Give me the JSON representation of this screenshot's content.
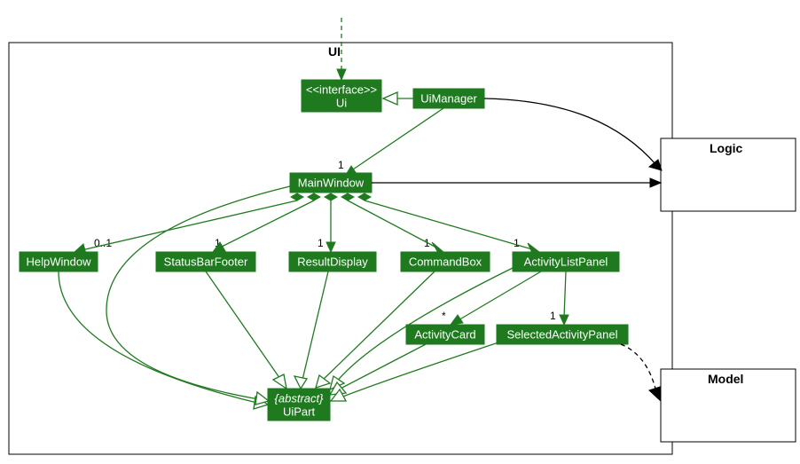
{
  "packages": {
    "ui": {
      "label": "UI"
    },
    "logic": {
      "label": "Logic"
    },
    "model": {
      "label": "Model"
    }
  },
  "nodes": {
    "ui_if": {
      "stereo": "<<interface>>",
      "name": "Ui"
    },
    "ui_manager": {
      "name": "UiManager"
    },
    "main_window": {
      "name": "MainWindow"
    },
    "help": {
      "name": "HelpWindow"
    },
    "status": {
      "name": "StatusBarFooter"
    },
    "result": {
      "name": "ResultDisplay"
    },
    "command": {
      "name": "CommandBox"
    },
    "list_panel": {
      "name": "ActivityListPanel"
    },
    "card": {
      "name": "ActivityCard"
    },
    "sel_panel": {
      "name": "SelectedActivityPanel"
    },
    "ui_part": {
      "stereo": "{abstract}",
      "name": "UiPart"
    }
  },
  "multiplicities": {
    "main_window": "1",
    "help": "0..1",
    "status": "1",
    "result": "1",
    "command": "1",
    "list_panel": "1",
    "card": "*",
    "sel_panel": "1"
  }
}
